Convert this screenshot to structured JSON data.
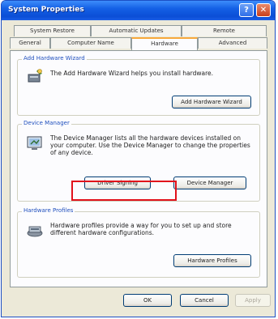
{
  "window": {
    "title": "System Properties",
    "help_label": "?",
    "close_label": "✕"
  },
  "tabs": {
    "row_back": [
      "System Restore",
      "Automatic Updates",
      "Remote"
    ],
    "row_front": [
      "General",
      "Computer Name",
      "Hardware",
      "Advanced"
    ],
    "active": "Hardware"
  },
  "add_hardware": {
    "legend": "Add Hardware Wizard",
    "description": "The Add Hardware Wizard helps you install hardware.",
    "button": "Add Hardware Wizard"
  },
  "device_manager": {
    "legend": "Device Manager",
    "description": "The Device Manager lists all the hardware devices installed on your computer. Use the Device Manager to change the properties of any device.",
    "driver_signing_button": "Driver Signing",
    "device_manager_button": "Device Manager"
  },
  "hardware_profiles": {
    "legend": "Hardware Profiles",
    "description": "Hardware profiles provide a way for you to set up and store different hardware configurations.",
    "button": "Hardware Profiles"
  },
  "footer": {
    "ok": "OK",
    "cancel": "Cancel",
    "apply": "Apply"
  },
  "colors": {
    "titlebar": "#0b4ed6",
    "dialog_bg": "#ece9d8",
    "group_legend": "#1f4fbd",
    "highlight_box": "#e1111b"
  }
}
